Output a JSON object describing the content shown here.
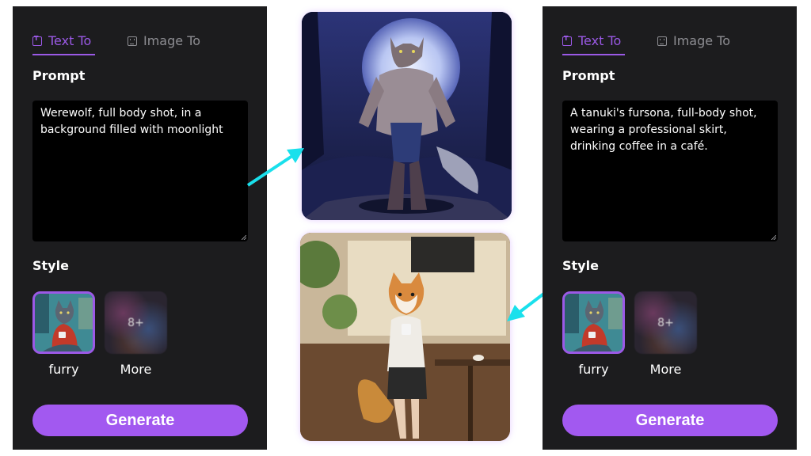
{
  "tabs": {
    "text_to": "Text To",
    "image_to": "Image To"
  },
  "headings": {
    "prompt": "Prompt",
    "style": "Style"
  },
  "left_panel": {
    "prompt_text": "Werewolf, full body shot, in a background filled with moonlight"
  },
  "right_panel": {
    "prompt_text": "A tanuki's fursona, full-body shot, wearing a professional skirt, drinking coffee in a café."
  },
  "styles": {
    "furry_label": "furry",
    "more_label": "More",
    "more_count": "8+"
  },
  "generate_label": "Generate",
  "colors": {
    "accent": "#9b59e6",
    "button": "#a259f0",
    "arrow": "#19e0ec",
    "panel": "#1c1c1e"
  }
}
